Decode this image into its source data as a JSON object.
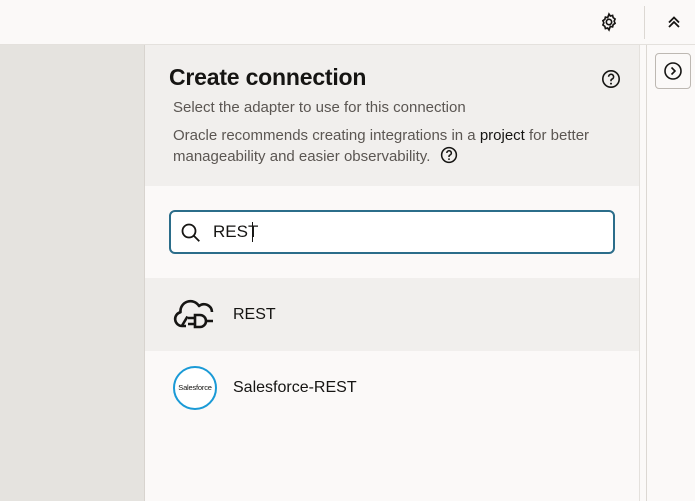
{
  "header": {
    "settings_icon": "gear-icon",
    "collapse_icon": "chevrons-up-icon"
  },
  "drawer": {
    "title": "Create connection",
    "subtitle": "Select the adapter to use for this connection",
    "recommend_prefix": "Oracle recommends creating integrations in a ",
    "recommend_link": "project",
    "recommend_suffix": " for better manageability and easier observability.",
    "search": {
      "value": "REST",
      "placeholder": ""
    },
    "results": [
      {
        "label": "REST",
        "icon": "rest-plug-cloud-icon",
        "selected": true
      },
      {
        "label": "Salesforce-REST",
        "icon": "salesforce-logo",
        "logo_text": "Salesforce",
        "selected": false
      }
    ]
  },
  "rail": {
    "expand_icon": "chevron-right-circle-icon"
  },
  "colors": {
    "accent": "#2b6d8a",
    "salesforce_blue": "#1a9ad6",
    "header_bg": "#f1efed"
  }
}
